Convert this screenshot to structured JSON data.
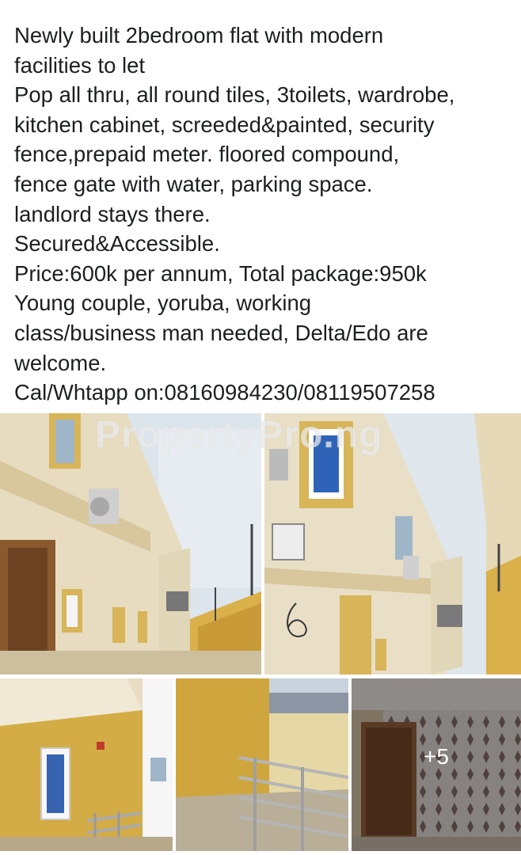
{
  "post": {
    "lines": [
      "Newly built 2bedroom flat with modern",
      "facilities to let",
      "Pop all thru, all round tiles, 3toilets, wardrobe,",
      "kitchen cabinet, screeded&painted, security",
      "fence,prepaid meter. floored compound,",
      "fence gate with water, parking space.",
      "landlord stays there.",
      "Secured&Accessible.",
      "Price:600k per annum, Total package:950k",
      "Young couple, yoruba, working",
      "class/business man needed, Delta/Edo are",
      "welcome.",
      "Cal/Whtapp on:08160984230/08119507258"
    ]
  },
  "gallery": {
    "watermark": "PropertyPro.ng",
    "more_count_label": "+5"
  },
  "colors": {
    "text": "#1c1e21",
    "wall_cream": "#e9dfc6",
    "wall_yellow": "#d9b04a",
    "sky": "#dfe6ec"
  }
}
